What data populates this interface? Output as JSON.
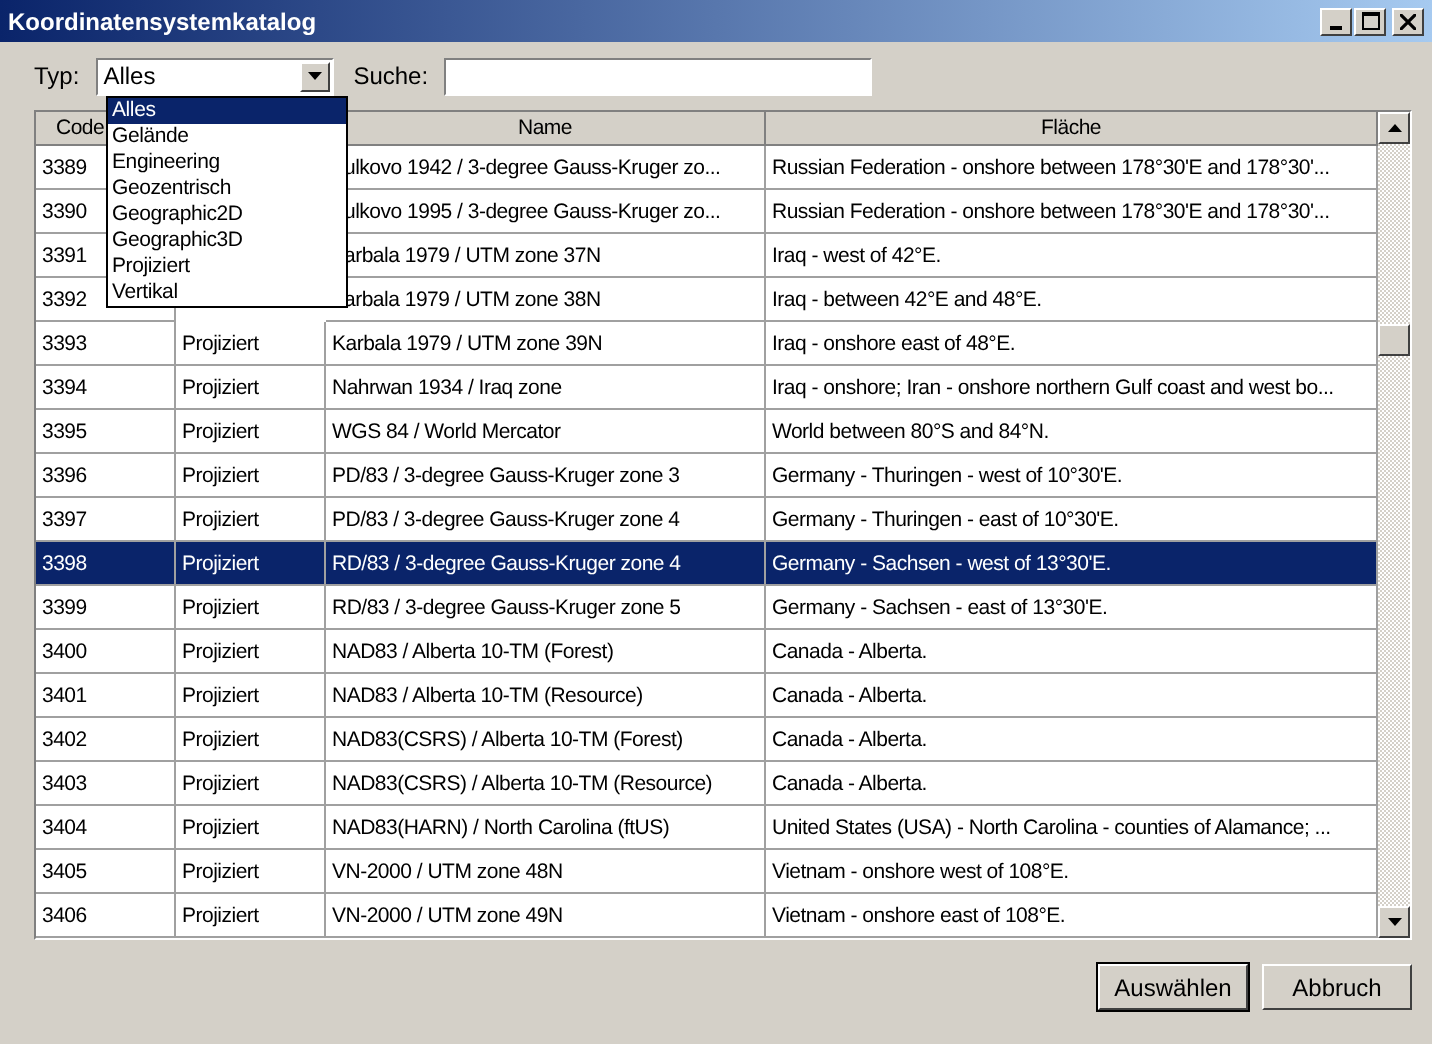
{
  "window": {
    "title": "Koordinatensystemkatalog"
  },
  "filter": {
    "type_label": "Typ:",
    "type_value": "Alles",
    "search_label": "Suche:",
    "dropdown": [
      {
        "label": "Alles",
        "selected": true
      },
      {
        "label": "Gelände",
        "selected": false
      },
      {
        "label": "Engineering",
        "selected": false
      },
      {
        "label": "Geozentrisch",
        "selected": false
      },
      {
        "label": "Geographic2D",
        "selected": false
      },
      {
        "label": "Geographic3D",
        "selected": false
      },
      {
        "label": "Projiziert",
        "selected": false
      },
      {
        "label": "Vertikal",
        "selected": false
      }
    ]
  },
  "table": {
    "columns": [
      "Code",
      "Name",
      "Fläche"
    ],
    "rows": [
      {
        "code": "3389",
        "name": "ulkovo 1942 / 3-degree Gauss-Kruger zo...",
        "area": "Russian Federation - onshore between 178°30'E and 178°30'...",
        "selected": false
      },
      {
        "code": "3390",
        "name": "ulkovo 1995 / 3-degree Gauss-Kruger zo...",
        "area": "Russian Federation - onshore between 178°30'E and 178°30'...",
        "selected": false
      },
      {
        "code": "3391",
        "name": "arbala 1979 / UTM zone 37N",
        "area": "Iraq - west of 42°E.",
        "selected": false
      },
      {
        "code": "3392",
        "name": "arbala 1979 / UTM zone 38N",
        "area": "Iraq - between 42°E and 48°E.",
        "selected": false
      },
      {
        "code": "3393",
        "type": "Projiziert",
        "name": "Karbala 1979 / UTM zone 39N",
        "area": "Iraq - onshore east of 48°E.",
        "selected": false
      },
      {
        "code": "3394",
        "type": "Projiziert",
        "name": "Nahrwan 1934 / Iraq zone",
        "area": "Iraq - onshore; Iran - onshore northern Gulf coast and west bo...",
        "selected": false
      },
      {
        "code": "3395",
        "type": "Projiziert",
        "name": "WGS 84 / World Mercator",
        "area": "World between 80°S and 84°N.",
        "selected": false
      },
      {
        "code": "3396",
        "type": "Projiziert",
        "name": "PD/83 / 3-degree Gauss-Kruger zone 3",
        "area": "Germany - Thuringen - west of 10°30'E.",
        "selected": false
      },
      {
        "code": "3397",
        "type": "Projiziert",
        "name": "PD/83 / 3-degree Gauss-Kruger zone 4",
        "area": "Germany - Thuringen - east of 10°30'E.",
        "selected": false
      },
      {
        "code": "3398",
        "type": "Projiziert",
        "name": "RD/83 / 3-degree Gauss-Kruger zone 4",
        "area": "Germany - Sachsen - west of 13°30'E.",
        "selected": true
      },
      {
        "code": "3399",
        "type": "Projiziert",
        "name": "RD/83 / 3-degree Gauss-Kruger zone 5",
        "area": "Germany - Sachsen - east of 13°30'E.",
        "selected": false
      },
      {
        "code": "3400",
        "type": "Projiziert",
        "name": "NAD83 / Alberta 10-TM (Forest)",
        "area": "Canada - Alberta.",
        "selected": false
      },
      {
        "code": "3401",
        "type": "Projiziert",
        "name": "NAD83 / Alberta 10-TM (Resource)",
        "area": "Canada - Alberta.",
        "selected": false
      },
      {
        "code": "3402",
        "type": "Projiziert",
        "name": "NAD83(CSRS) / Alberta 10-TM (Forest)",
        "area": "Canada - Alberta.",
        "selected": false
      },
      {
        "code": "3403",
        "type": "Projiziert",
        "name": "NAD83(CSRS) / Alberta 10-TM (Resource)",
        "area": "Canada - Alberta.",
        "selected": false
      },
      {
        "code": "3404",
        "type": "Projiziert",
        "name": "NAD83(HARN) / North Carolina (ftUS)",
        "area": "United States (USA) - North Carolina - counties of Alamance; ...",
        "selected": false
      },
      {
        "code": "3405",
        "type": "Projiziert",
        "name": "VN-2000 / UTM zone 48N",
        "area": "Vietnam - onshore west of 108°E.",
        "selected": false
      },
      {
        "code": "3406",
        "type": "Projiziert",
        "name": "VN-2000 / UTM zone 49N",
        "area": "Vietnam - onshore east of 108°E.",
        "selected": false
      }
    ]
  },
  "buttons": [
    "Auswählen",
    "Abbruch"
  ]
}
